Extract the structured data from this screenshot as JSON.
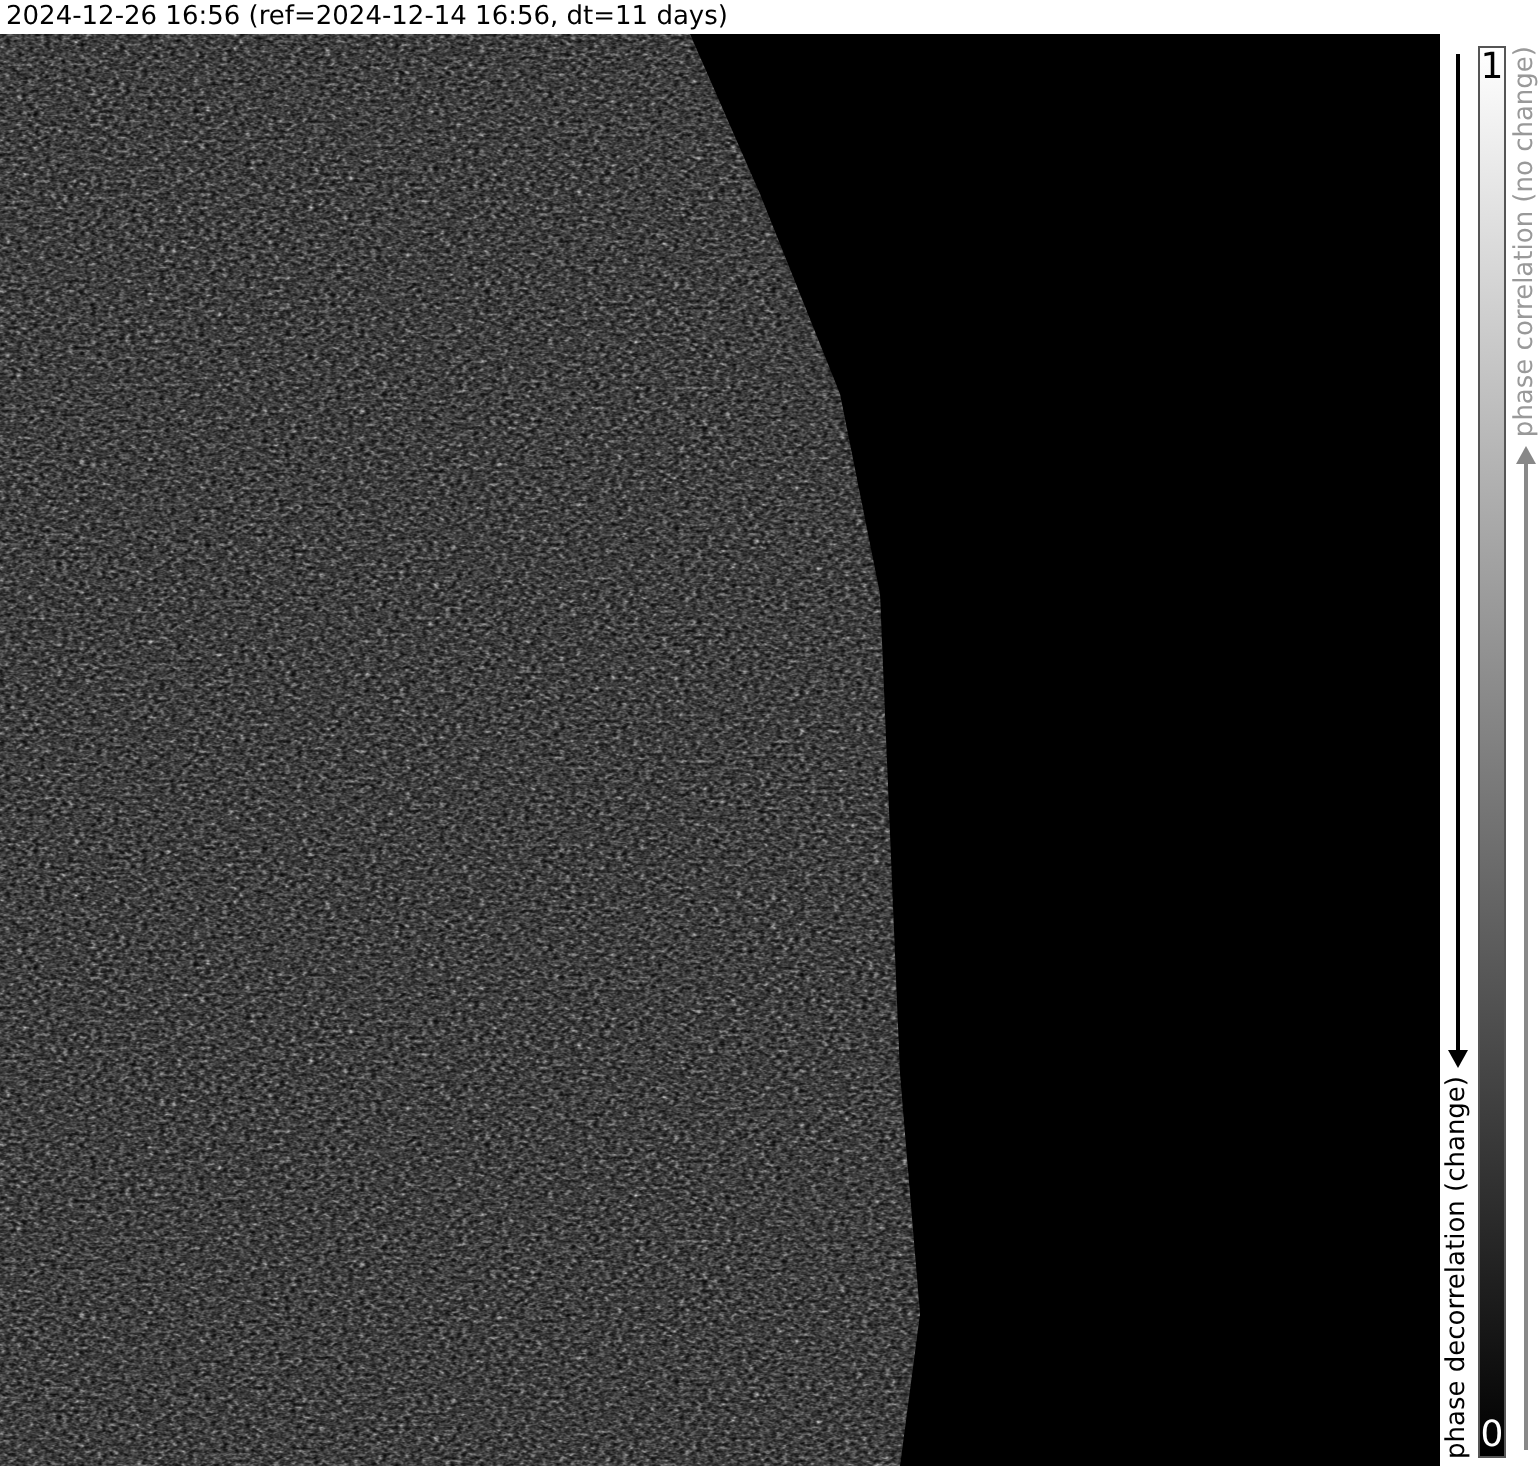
{
  "title": "2024-12-26 16:56 (ref=2024-12-14 16:56, dt=11 days)",
  "colorbar": {
    "max_label": "1",
    "min_label": "0",
    "top_caption": "phase correlation (no change)",
    "bottom_caption": "phase decorrelation (change)"
  }
}
